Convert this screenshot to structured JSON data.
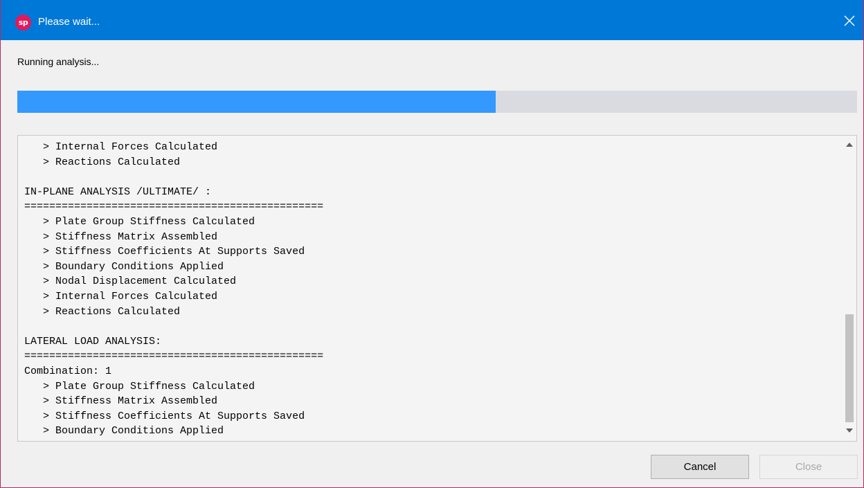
{
  "window": {
    "app_icon_text": "sp",
    "title": "Please wait..."
  },
  "status": {
    "text": "Running analysis..."
  },
  "progress": {
    "percent": 57
  },
  "log": {
    "lines": [
      "   > Internal Forces Calculated",
      "   > Reactions Calculated",
      "",
      "IN-PLANE ANALYSIS /ULTIMATE/ :",
      "================================================",
      "   > Plate Group Stiffness Calculated",
      "   > Stiffness Matrix Assembled",
      "   > Stiffness Coefficients At Supports Saved",
      "   > Boundary Conditions Applied",
      "   > Nodal Displacement Calculated",
      "   > Internal Forces Calculated",
      "   > Reactions Calculated",
      "",
      "LATERAL LOAD ANALYSIS:",
      "================================================",
      "Combination: 1",
      "   > Plate Group Stiffness Calculated",
      "   > Stiffness Matrix Assembled",
      "   > Stiffness Coefficients At Supports Saved",
      "   > Boundary Conditions Applied"
    ]
  },
  "buttons": {
    "cancel_label": "Cancel",
    "close_label": "Close"
  },
  "colors": {
    "titlebar": "#0078d7",
    "app_icon": "#e2195b",
    "progress_fill": "#3399ff",
    "progress_track": "#d9dbe1"
  },
  "icons": {
    "app": "sp-logo-icon",
    "close": "close-icon",
    "scroll_up": "scroll-up-arrow-icon",
    "scroll_down": "scroll-down-arrow-icon"
  }
}
